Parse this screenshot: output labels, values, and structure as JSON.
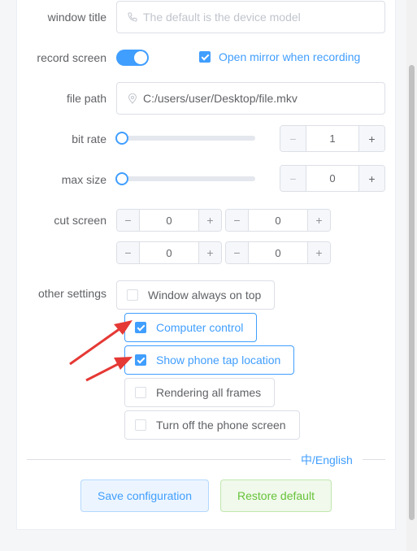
{
  "fields": {
    "window_title": {
      "label": "window title",
      "placeholder": "The default is the device model"
    },
    "record_screen": {
      "label": "record screen",
      "enabled": true,
      "mirror_label": "Open mirror when recording",
      "mirror_checked": true
    },
    "file_path": {
      "label": "file path",
      "value": "C:/users/user/Desktop/file.mkv"
    },
    "bit_rate": {
      "label": "bit rate",
      "value": "1",
      "minus": "−",
      "plus": "+"
    },
    "max_size": {
      "label": "max size",
      "value": "0",
      "minus": "−",
      "plus": "+"
    },
    "cut_screen": {
      "label": "cut screen",
      "steppers": [
        {
          "value": "0",
          "minus": "−",
          "plus": "+"
        },
        {
          "value": "0",
          "minus": "−",
          "plus": "+"
        },
        {
          "value": "0",
          "minus": "−",
          "plus": "+"
        },
        {
          "value": "0",
          "minus": "−",
          "plus": "+"
        }
      ]
    },
    "other_settings": {
      "label": "other settings",
      "options": [
        {
          "label": "Window always on top",
          "checked": false
        },
        {
          "label": "Computer control",
          "checked": true
        },
        {
          "label": "Show phone tap location",
          "checked": true
        },
        {
          "label": "Rendering all frames",
          "checked": false
        },
        {
          "label": "Turn off the phone screen",
          "checked": false
        }
      ]
    }
  },
  "language_toggle": "中/English",
  "buttons": {
    "save": "Save configuration",
    "restore": "Restore default"
  },
  "colors": {
    "accent": "#409eff",
    "success": "#67c23a",
    "annotation_arrow": "#e53935"
  },
  "icons": {
    "window_title": "phone-icon",
    "file_path": "location-pin-icon"
  }
}
